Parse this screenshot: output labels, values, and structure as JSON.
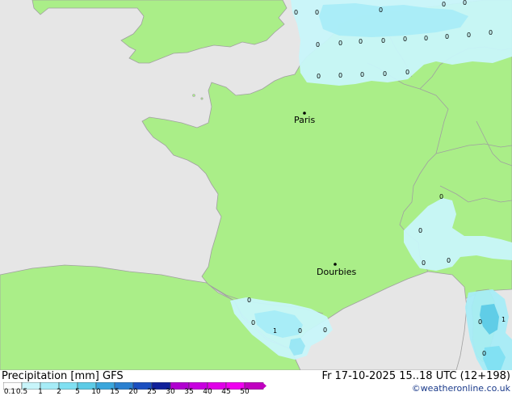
{
  "map": {
    "cities": [
      {
        "name": "Paris"
      },
      {
        "name": "Dourbies"
      }
    ],
    "precip_values": [
      "0",
      "0",
      "0",
      "0",
      "0",
      "0",
      "0",
      "0",
      "0",
      "0",
      "0",
      "0",
      "0",
      "0",
      "0",
      "0",
      "0",
      "0",
      "0",
      "0",
      "0",
      "0",
      "0",
      "0",
      "0",
      "1",
      "0",
      "0",
      "0",
      "1",
      "0"
    ],
    "colors": {
      "sea": "#e6e6e6",
      "land": "#aaee88",
      "light_precip": "#c8f5fa",
      "mid_precip": "#98e6f4",
      "heavy_precip": "#5ccbe6",
      "border": "#a0a0a0"
    }
  },
  "footer": {
    "title": "Precipitation [mm] GFS",
    "datetime": "Fr 17-10-2025 15..18 UTC (12+198)",
    "credit": "©weatheronline.co.uk",
    "scale_labels": [
      "0.1",
      "0.5",
      "1",
      "2",
      "5",
      "10",
      "15",
      "20",
      "25",
      "30",
      "35",
      "40",
      "45",
      "50"
    ],
    "scale_colors": [
      "#fdfdfd",
      "#c8f5fa",
      "#a6ecf7",
      "#80e0f2",
      "#5ccbe6",
      "#3aa6dc",
      "#2a80d0",
      "#1a4fc0",
      "#10209a",
      "#b000d0",
      "#c800e0",
      "#e000e8",
      "#f000f0",
      "#c000c0"
    ]
  }
}
